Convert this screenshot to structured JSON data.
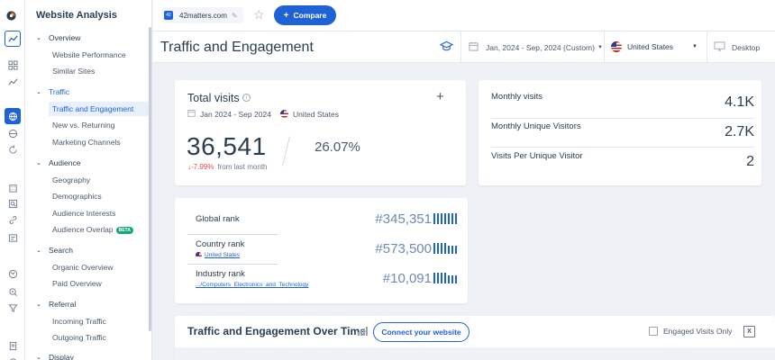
{
  "sidebar": {
    "title": "Website Analysis",
    "sections": [
      {
        "label": "Overview",
        "items": [
          "Website Performance",
          "Similar Sites"
        ]
      },
      {
        "label": "Traffic",
        "items": [
          "Traffic and Engagement",
          "New vs. Returning",
          "Marketing Channels"
        ]
      },
      {
        "label": "Audience",
        "items": [
          "Geography",
          "Demographics",
          "Audience Interests",
          "Audience Overlap"
        ]
      },
      {
        "label": "Search",
        "items": [
          "Organic Overview",
          "Paid Overview"
        ]
      },
      {
        "label": "Referral",
        "items": [
          "Incoming Traffic",
          "Outgoing Traffic"
        ]
      },
      {
        "label": "Display",
        "items": []
      }
    ],
    "beta_badge": "BETA",
    "active_item": "Traffic and Engagement"
  },
  "topbar": {
    "favicon_text": "42",
    "domain": "42matters.com",
    "compare_label": "Compare"
  },
  "header": {
    "page_title": "Traffic and Engagement",
    "date_range": "Jan, 2024 - Sep, 2024 (Custom)",
    "country": "United States",
    "device": "Desktop"
  },
  "total_visits": {
    "title": "Total visits",
    "period": "Jan 2024 - Sep 2024",
    "country": "United States",
    "value": "36,541",
    "share": "26.07%",
    "change": "-7.99%",
    "change_label": "from last month"
  },
  "monthly": [
    {
      "label": "Monthly visits",
      "value": "4.1K"
    },
    {
      "label": "Monthly Unique Visitors",
      "value": "2.7K"
    },
    {
      "label": "Visits Per Unique Visitor",
      "value": "2"
    }
  ],
  "ranks": {
    "global": {
      "label": "Global rank",
      "value": "#345,351"
    },
    "country": {
      "label": "Country rank",
      "sub": "United States",
      "value": "#573,500"
    },
    "industry": {
      "label": "Industry rank",
      "sub": ".../Computers_Electronics_and_Technology",
      "value": "#10,091"
    }
  },
  "over_time": {
    "title": "Traffic and Engagement Over Time",
    "connect_label": "Connect your website",
    "engaged_label": "Engaged Visits Only",
    "excel_label": "X"
  },
  "colors": {
    "accent": "#1f62d5",
    "negative": "#e5484d",
    "positive_badge": "#1aa774"
  }
}
